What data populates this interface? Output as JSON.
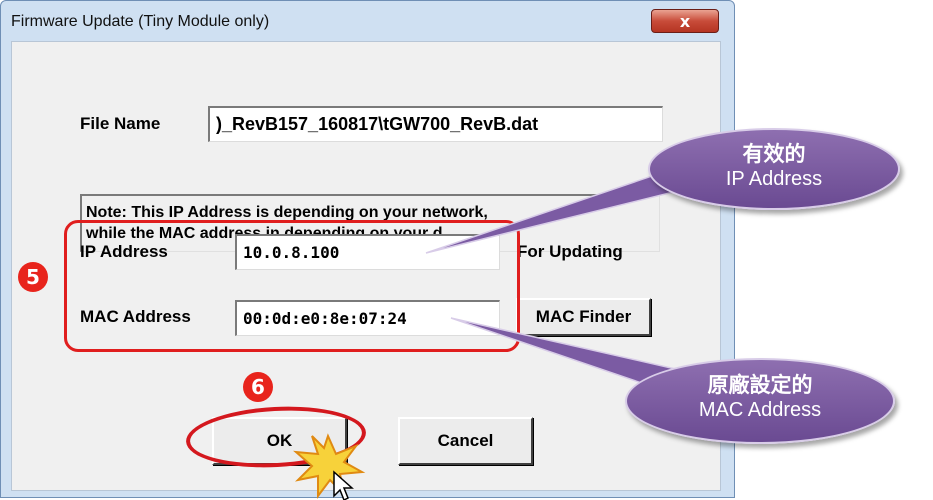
{
  "window": {
    "title": "Firmware Update (Tiny Module only)",
    "close_label": "x"
  },
  "form": {
    "file_name_label": "File Name",
    "file_name_value": ")_RevB157_160817\\tGW700_RevB.dat",
    "note_line1": "Note: This IP Address is depending on your network,",
    "note_line2": "while the  MAC address in depending on your d",
    "ip_label": "IP Address",
    "ip_value": "10.0.8.100",
    "ip_hint": "For Updating",
    "mac_label": "MAC Address",
    "mac_value": "00:0d:e0:8e:07:24",
    "mac_finder_label": "MAC Finder",
    "ok_label": "OK",
    "cancel_label": "Cancel"
  },
  "annotations": {
    "step5": "5",
    "step6": "6",
    "ip_callout_line1": "有效的",
    "ip_callout_line2": "IP Address",
    "mac_callout_line1": "原廠設定的",
    "mac_callout_line2": "MAC Address",
    "highlight_color": "#e01e1e",
    "callout_color": "#7b5ba3"
  }
}
